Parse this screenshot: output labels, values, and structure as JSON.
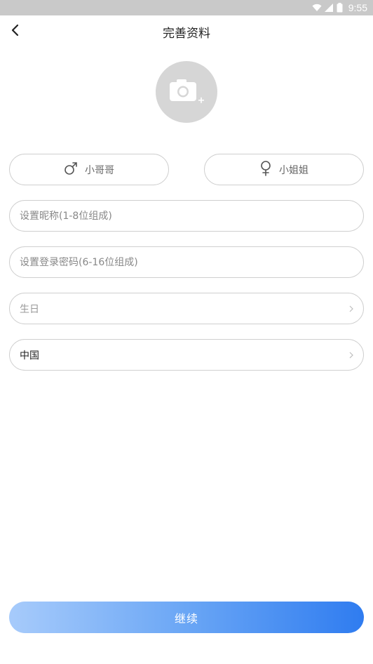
{
  "status_bar": {
    "time": "9:55",
    "icons": [
      "wifi-icon",
      "cell-signal-icon",
      "battery-icon"
    ]
  },
  "header": {
    "title": "完善资料",
    "back_icon": "chevron-left-icon"
  },
  "avatar": {
    "icon": "camera-add-icon",
    "bg_color": "#d6d6d6"
  },
  "gender": {
    "male_label": "小哥哥",
    "male_icon": "male-symbol-icon",
    "female_label": "小姐姐",
    "female_icon": "female-symbol-icon"
  },
  "form": {
    "nickname_placeholder": "设置昵称(1-8位组成)",
    "nickname_value": "",
    "password_placeholder": "设置登录密码(6-16位组成)",
    "password_value": "",
    "birthday_placeholder": "生日",
    "country_value": "中国"
  },
  "continue_label": "继续",
  "colors": {
    "accent_start": "#a7cbfb",
    "accent_end": "#2f7cf0",
    "border": "#cfcfcf",
    "caret": "#e0315a"
  }
}
